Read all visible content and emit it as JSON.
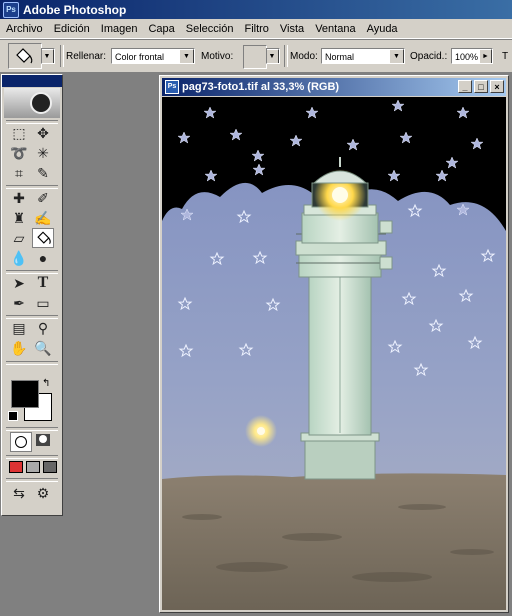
{
  "app": {
    "title": "Adobe Photoshop",
    "logo_text": "Ps"
  },
  "menu": [
    "Archivo",
    "Edición",
    "Imagen",
    "Capa",
    "Selección",
    "Filtro",
    "Vista",
    "Ventana",
    "Ayuda"
  ],
  "options": {
    "fill_label": "Rellenar:",
    "fill_value": "Color frontal",
    "pattern_label": "Motivo:",
    "mode_label": "Modo:",
    "mode_value": "Normal",
    "opacity_label": "Opacid.:",
    "opacity_value": "100%",
    "tolerance_label_cut": "T"
  },
  "document": {
    "title": "pag73-foto1.tif al 33,3% (RGB)",
    "minimize": "_",
    "maximize": "□",
    "close": "×"
  },
  "colors": {
    "foreground": "#000000",
    "background": "#ffffff",
    "accent": "#0a246a",
    "sky_night": "#000000",
    "sky_dusk": "#8e9cc4"
  },
  "tools": [
    "rectangular-marquee-icon",
    "move-icon",
    "lasso-icon",
    "magic-wand-icon",
    "crop-icon",
    "slice-icon",
    "healing-brush-icon",
    "brush-icon",
    "clone-stamp-icon",
    "history-brush-icon",
    "eraser-icon",
    "paint-bucket-icon",
    "blur-icon",
    "dodge-icon",
    "path-selection-icon",
    "type-icon",
    "pen-icon",
    "rectangle-shape-icon",
    "notes-icon",
    "eyedropper-icon",
    "hand-icon",
    "zoom-icon"
  ]
}
